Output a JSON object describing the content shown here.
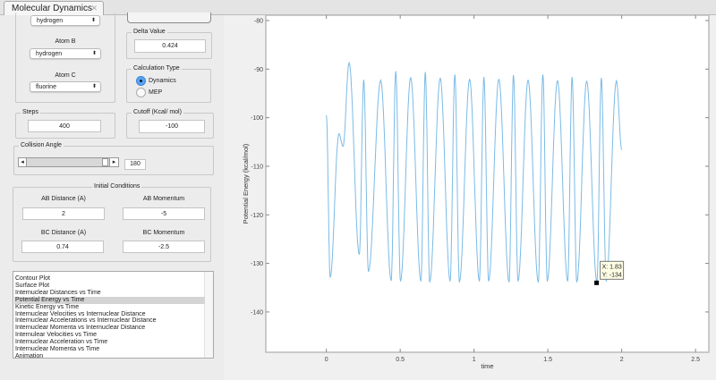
{
  "window": {
    "tab_title": "Molecular Dynamics",
    "close_glyph": "✕"
  },
  "atoms": {
    "atom_a_value": "hydrogen",
    "atom_b_label": "Atom B",
    "atom_b_value": "hydrogen",
    "atom_c_label": "Atom C",
    "atom_c_value": "fluorine",
    "dropdown_arrow": "⬍"
  },
  "delta": {
    "label": "Delta Value",
    "value": "0.424"
  },
  "calc_type": {
    "label": "Calculation Type",
    "options": [
      "Dynamics",
      "MEP"
    ],
    "selected": "Dynamics"
  },
  "steps": {
    "label": "Steps",
    "value": "400"
  },
  "cutoff": {
    "label": "Cutoff (Kcal/ mol)",
    "value": "-100"
  },
  "collision": {
    "label": "Collision Angle",
    "value": "180",
    "slider_fraction": 1.0,
    "left_arrow": "◂",
    "right_arrow": "▸"
  },
  "initial": {
    "label": "Initial Conditions",
    "ab_distance_label": "AB Distance (A)",
    "ab_distance": "2",
    "ab_momentum_label": "AB Momentum",
    "ab_momentum": "-5",
    "bc_distance_label": "BC Distance (A)",
    "bc_distance": "0.74",
    "bc_momentum_label": "BC Momentum",
    "bc_momentum": "-2.5"
  },
  "plot_list": {
    "items": [
      "Contour Plot",
      "Surface Plot",
      "Internuclear Distances vs Time",
      "Potential Energy vs Time",
      "Kinetic Energy vs Time",
      "Internuclear Velocities vs Internuclear Distance",
      "Internuclear Accelerations vs Internuclear Distance",
      "Internuclear Momenta vs Internuclear Distance",
      "Internulear Velocities vs Time",
      "Internuclear Acceleration vs Time",
      "Internuclear Momenta vs Time",
      "Animation"
    ],
    "selected_index": 3
  },
  "chart_data": {
    "type": "line",
    "title": "",
    "xlabel": "time",
    "ylabel": "Potential Energy (kcal/mol)",
    "xlim": [
      -0.41,
      2.59
    ],
    "ylim": [
      -148.3,
      -78.9
    ],
    "xticks": [
      "0",
      "0.5",
      "1",
      "1.5",
      "2",
      "2.5"
    ],
    "xtick_values": [
      0,
      0.5,
      1,
      1.5,
      2,
      2.5
    ],
    "yticks": [
      "-80",
      "-90",
      "-100",
      "-110",
      "-120",
      "-130",
      "-140"
    ],
    "ytick_values": [
      -80,
      -90,
      -100,
      -110,
      -120,
      -130,
      -140
    ],
    "line_color": "#7bbbe6",
    "series": [
      {
        "name": "Potential Energy",
        "extrema_x": [
          0,
          0.026,
          0.085,
          0.113,
          0.154,
          0.223,
          0.253,
          0.285,
          0.368,
          0.439,
          0.47,
          0.502,
          0.571,
          0.64,
          0.67,
          0.7,
          0.771,
          0.838,
          0.87,
          0.901,
          0.97,
          1.036,
          1.067,
          1.099,
          1.168,
          1.237,
          1.267,
          1.298,
          1.366,
          1.435,
          1.466,
          1.496,
          1.565,
          1.634,
          1.664,
          1.696,
          1.763,
          1.832,
          1.862,
          1.895,
          1.964,
          2.0
        ],
        "extrema_y": [
          -99.5,
          -132.9,
          -103.3,
          -105.9,
          -88.7,
          -128.2,
          -92.2,
          -131.7,
          -92.3,
          -133.6,
          -90.4,
          -133.7,
          -91.7,
          -133.7,
          -90.6,
          -133.9,
          -91.8,
          -133.7,
          -91.1,
          -133.9,
          -92.0,
          -133.7,
          -91.6,
          -133.7,
          -92.0,
          -133.9,
          -91.2,
          -133.7,
          -92.2,
          -133.9,
          -91.1,
          -133.7,
          -92.3,
          -133.7,
          -91.6,
          -133.9,
          -92.4,
          -133.9,
          -91.8,
          -133.7,
          -92.4,
          -106.6
        ]
      }
    ],
    "datatip": {
      "x": 1.83,
      "y": -134,
      "text_x": "X: 1.83",
      "text_y": "Y: -134"
    }
  }
}
